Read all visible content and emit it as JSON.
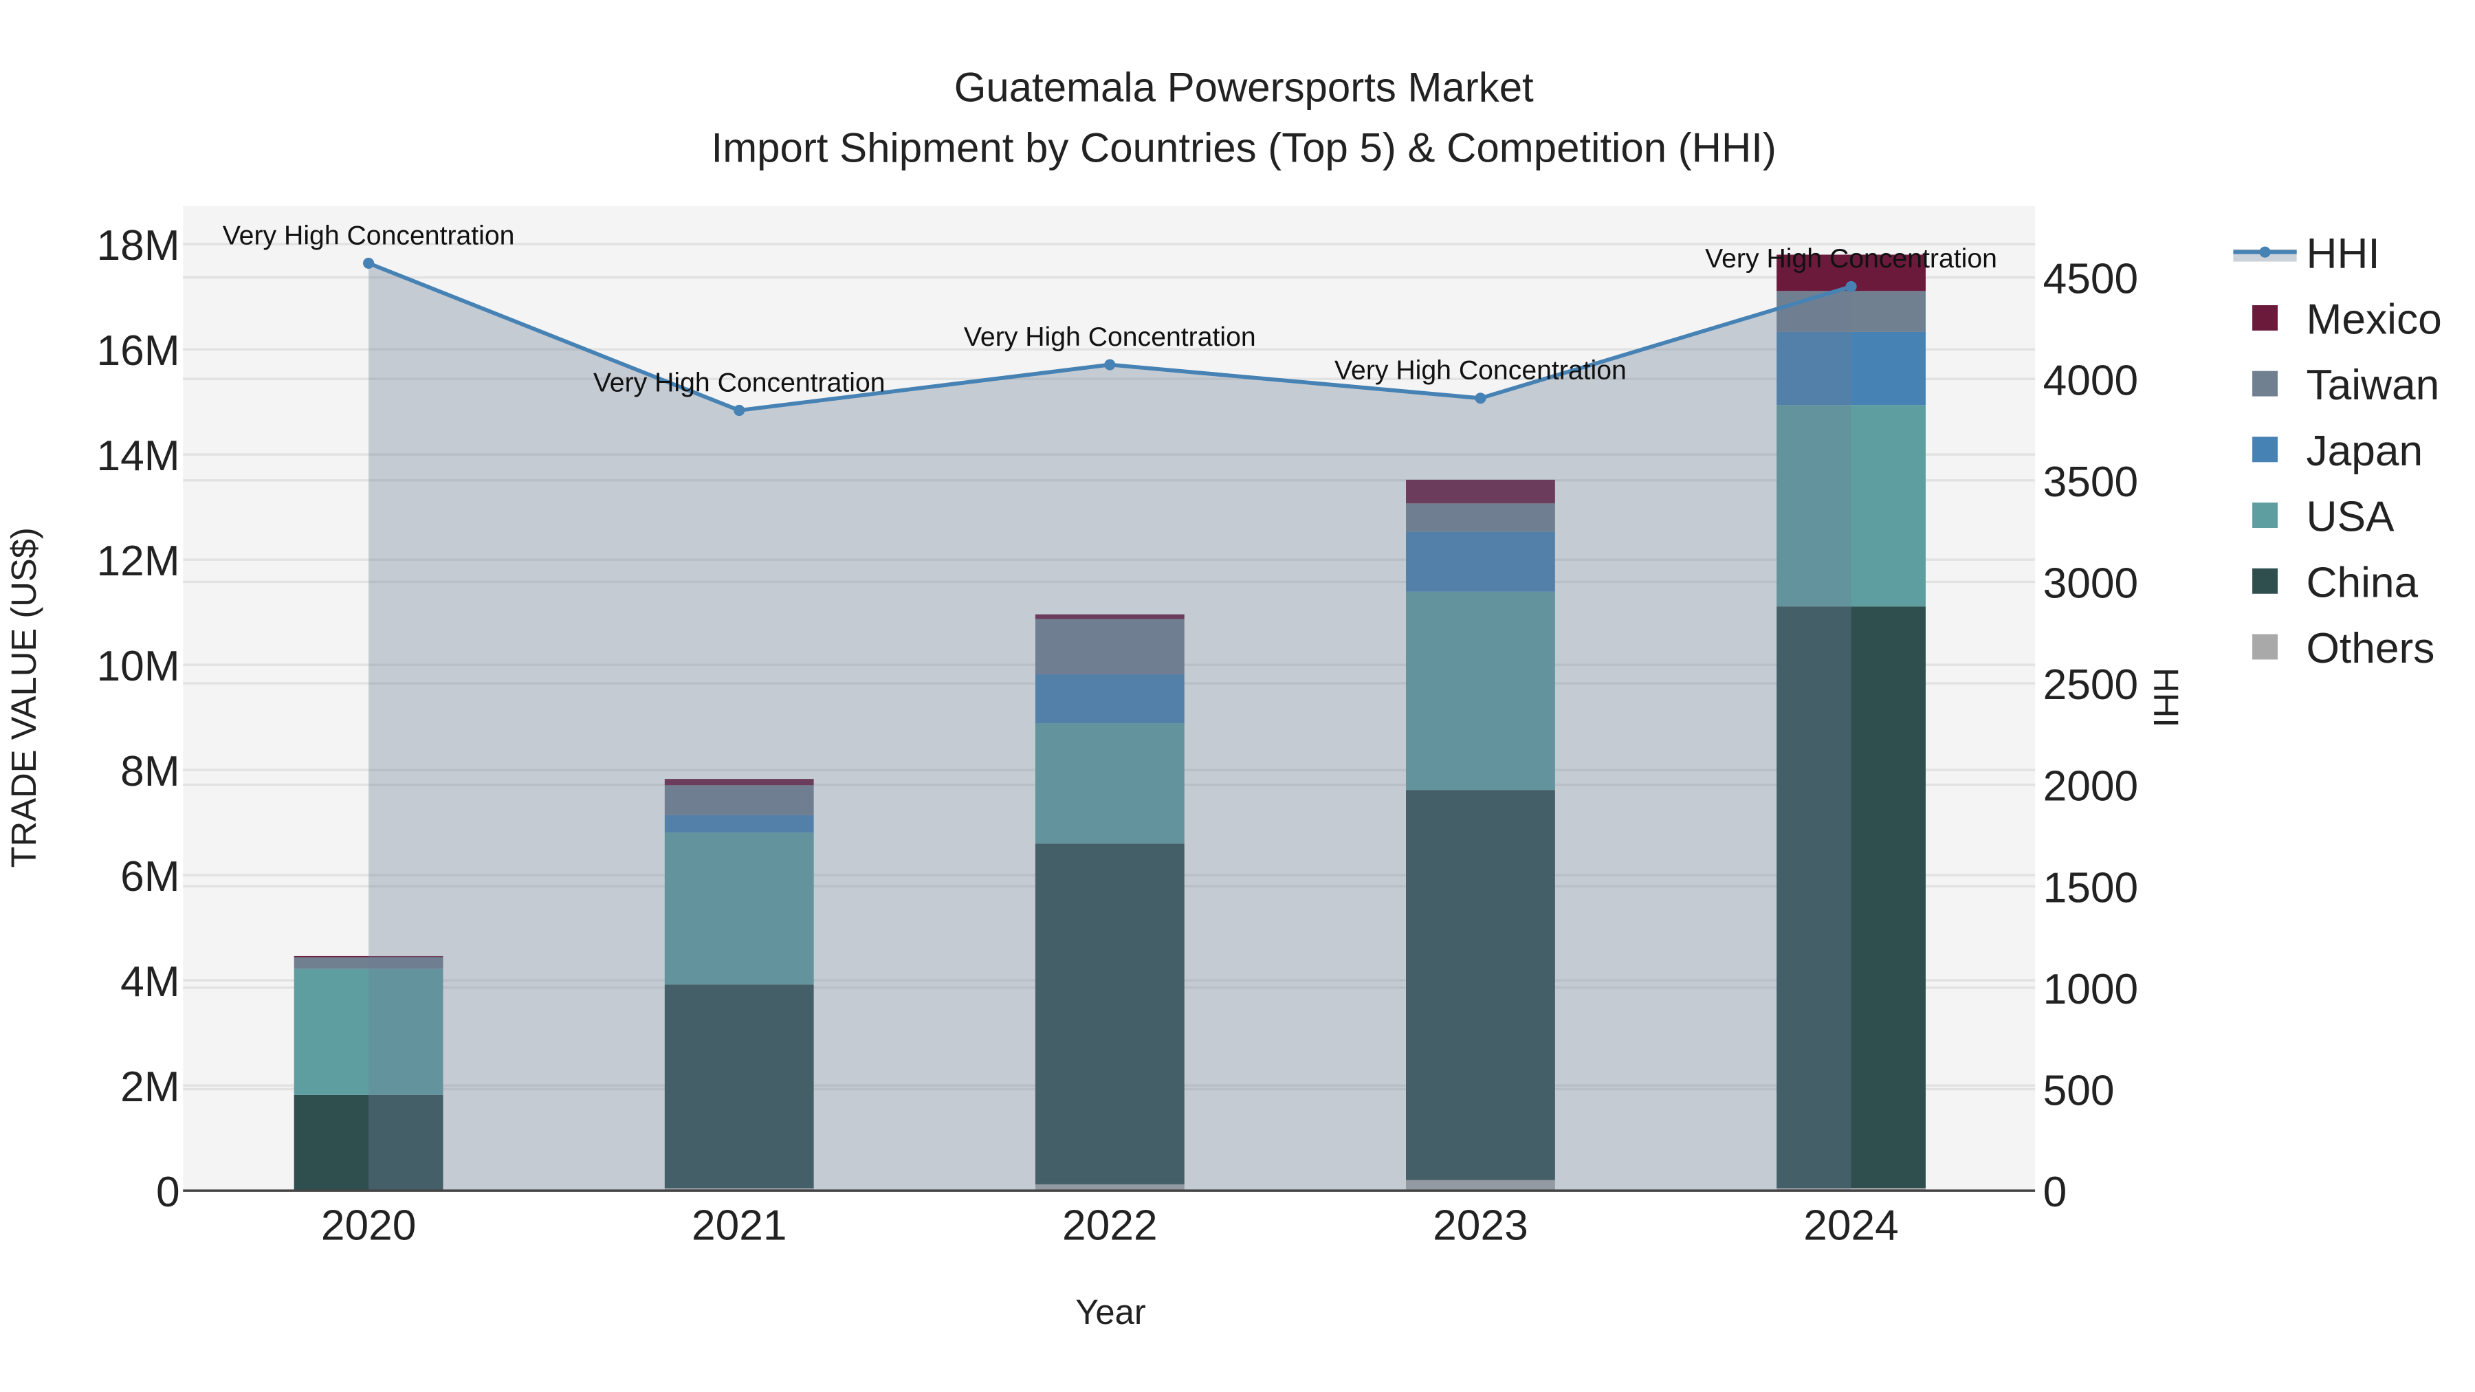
{
  "chart_data": {
    "type": "bar",
    "title_line1": "Guatemala Powersports Market",
    "title_line2": "Import Shipment by Countries (Top 5) & Competition (HHI)",
    "xlabel": "Year",
    "ylabel": "TRADE VALUE (US$)",
    "y2label": "HHI",
    "categories": [
      "2020",
      "2021",
      "2022",
      "2023",
      "2024"
    ],
    "ylim": [
      0,
      18.7
    ],
    "y_unit": "M",
    "y_ticks": [
      0,
      2,
      4,
      6,
      8,
      10,
      12,
      14,
      16,
      18
    ],
    "y_tick_labels": [
      "0",
      "2M",
      "4M",
      "6M",
      "8M",
      "10M",
      "12M",
      "14M",
      "16M",
      "18M"
    ],
    "y2lim": [
      0,
      4850
    ],
    "y2_ticks": [
      0,
      500,
      1000,
      1500,
      2000,
      2500,
      3000,
      3500,
      4000,
      4500
    ],
    "y2_tick_labels": [
      "0",
      "500",
      "1000",
      "1500",
      "2000",
      "2500",
      "3000",
      "3500",
      "4000",
      "4500"
    ],
    "series": [
      {
        "name": "Others",
        "color": "#a9a9a9",
        "values": [
          0.02,
          0.05,
          0.12,
          0.2,
          0.05
        ]
      },
      {
        "name": "China",
        "color": "#2f4f4f",
        "values": [
          1.8,
          3.87,
          6.48,
          7.42,
          11.06
        ]
      },
      {
        "name": "USA",
        "color": "#5f9ea0",
        "values": [
          2.4,
          2.89,
          2.29,
          3.77,
          3.83
        ]
      },
      {
        "name": "Japan",
        "color": "#4682b4",
        "values": [
          0.0,
          0.33,
          0.93,
          1.14,
          1.39
        ]
      },
      {
        "name": "Taiwan",
        "color": "#708090",
        "values": [
          0.22,
          0.57,
          1.05,
          0.54,
          0.78
        ]
      },
      {
        "name": "Mexico",
        "color": "#6b1a3c",
        "values": [
          0.02,
          0.12,
          0.09,
          0.45,
          0.69
        ]
      }
    ],
    "line": {
      "name": "HHI",
      "color": "#4682b4",
      "values": [
        4570,
        3845,
        4070,
        3905,
        4455
      ]
    },
    "annotations": [
      "Very High Concentration",
      "Very High Concentration",
      "Very High Concentration",
      "Very High Concentration",
      "Very High Concentration"
    ],
    "legend_order": [
      "HHI",
      "Mexico",
      "Taiwan",
      "Japan",
      "USA",
      "China",
      "Others"
    ],
    "legend_placement": "right"
  }
}
